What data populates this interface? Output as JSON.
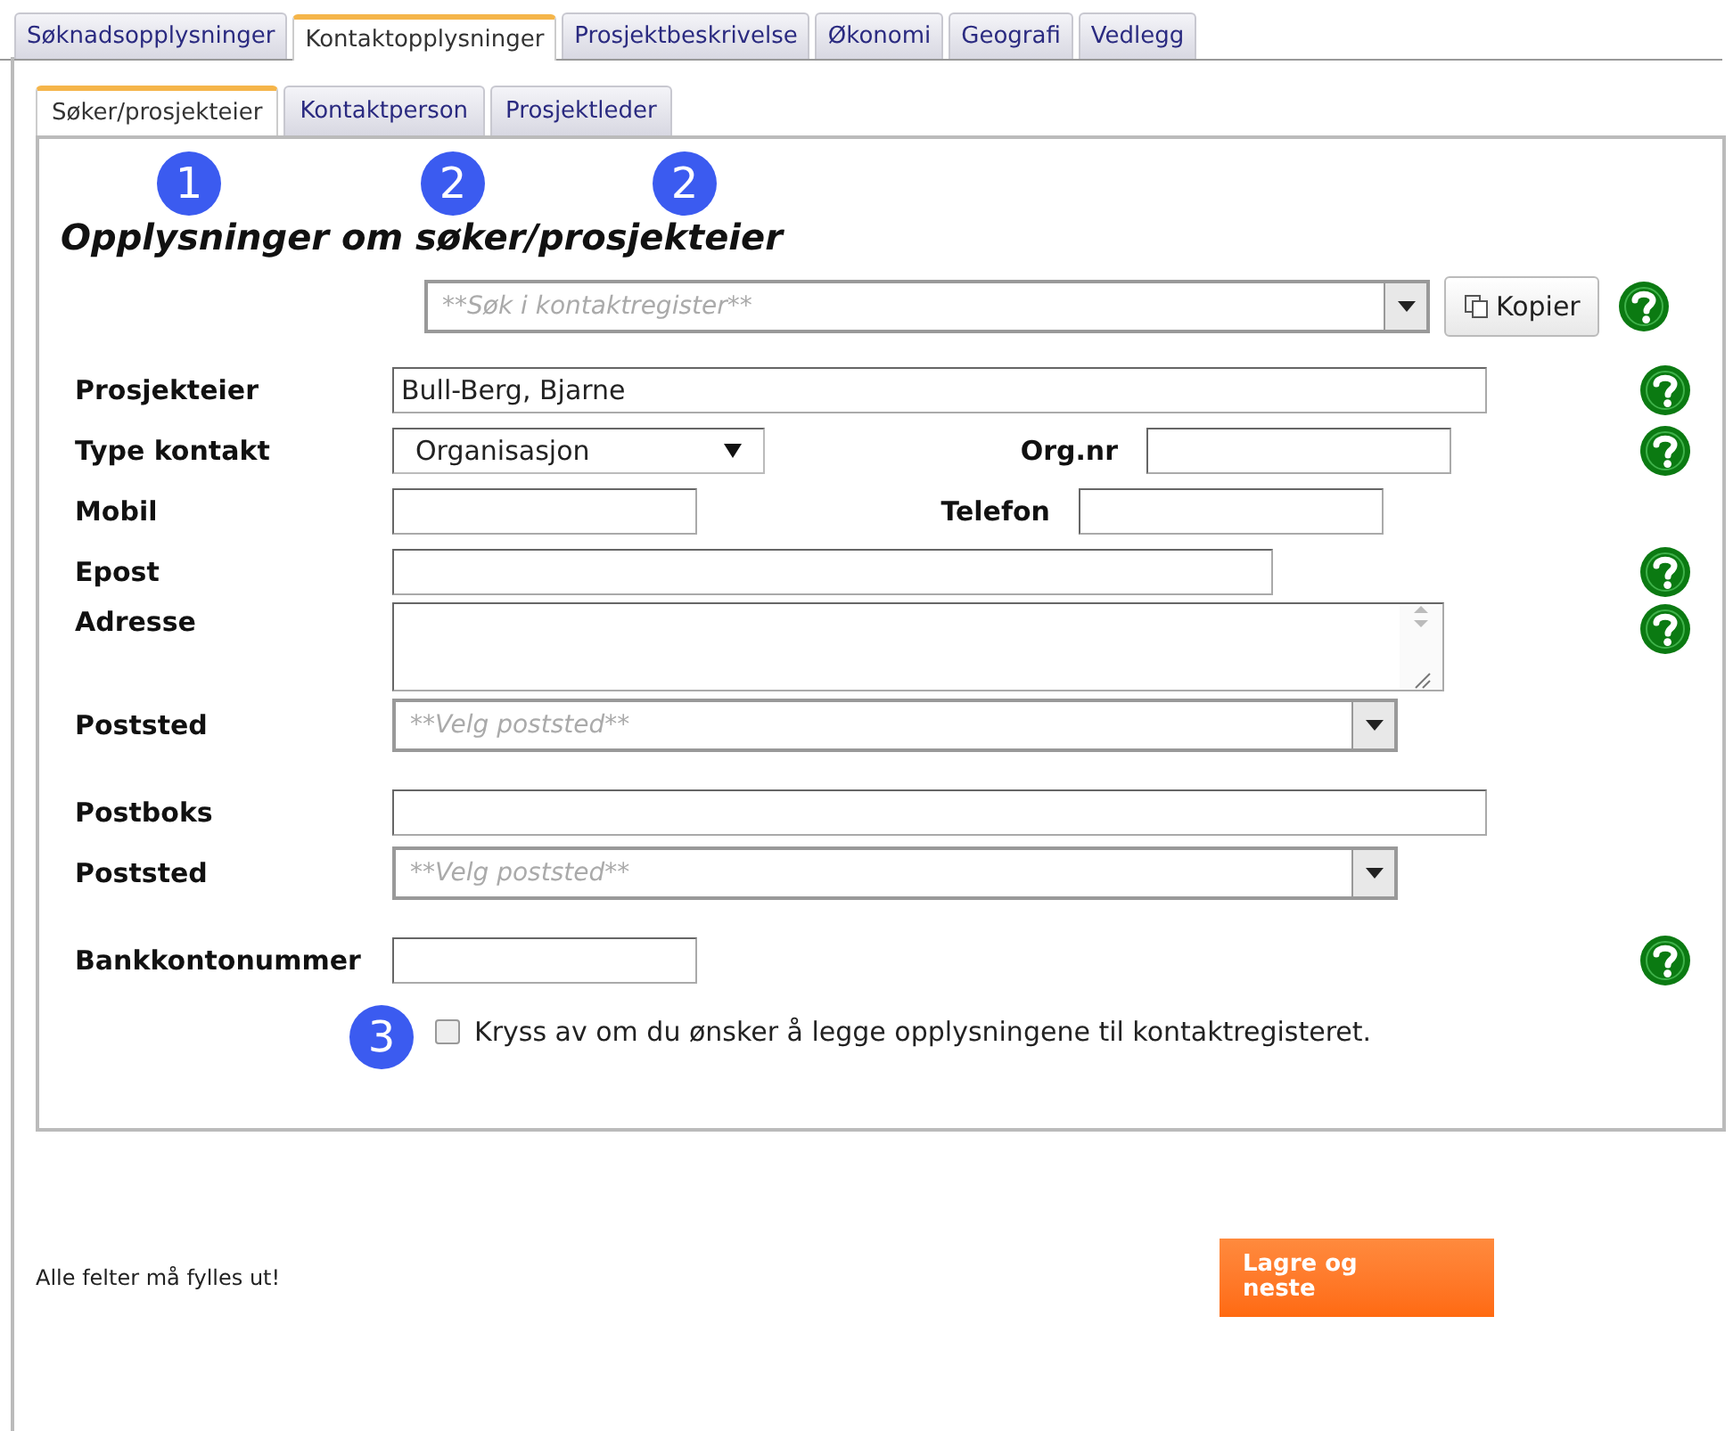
{
  "tabs": [
    {
      "label": "Søknadsopplysninger",
      "selected": false
    },
    {
      "label": "Kontaktopplysninger",
      "selected": true
    },
    {
      "label": "Prosjektbeskrivelse",
      "selected": false
    },
    {
      "label": "Økonomi",
      "selected": false
    },
    {
      "label": "Geografi",
      "selected": false
    },
    {
      "label": "Vedlegg",
      "selected": false
    }
  ],
  "subtabs": [
    {
      "label": "Søker/prosjekteier",
      "selected": true,
      "badge": "1"
    },
    {
      "label": "Kontaktperson",
      "selected": false,
      "badge": "2"
    },
    {
      "label": "Prosjektleder",
      "selected": false,
      "badge": "2"
    }
  ],
  "heading": "Opplysninger om søker/prosjekteier",
  "search": {
    "placeholder": "**Søk i kontaktregister**",
    "button": "Kopier",
    "help": true
  },
  "sections": [
    [
      {
        "label": "Prosjekteier",
        "field": {
          "kind": "text",
          "value": "Bull-Berg, Bjarne"
        },
        "help": true
      },
      {
        "label": "Type kontakt",
        "field": {
          "kind": "dropdown",
          "value": "Organisasjon"
        },
        "second": {
          "label": "Org.nr",
          "field": {
            "kind": "text"
          }
        },
        "help": true
      },
      {
        "label": "Mobil",
        "field": {
          "kind": "text"
        },
        "second": {
          "label": "Telefon",
          "field": {
            "kind": "text"
          }
        },
        "help": false
      },
      {
        "label": "Epost",
        "field": {
          "kind": "text"
        },
        "help": true
      },
      {
        "label": "Adresse",
        "field": {
          "kind": "textarea"
        },
        "help": true
      },
      {
        "label": "Poststed",
        "field": {
          "kind": "combo",
          "placeholder": "**Velg poststed**"
        },
        "help": false
      }
    ],
    [
      {
        "label": "Postboks",
        "field": {
          "kind": "text"
        },
        "help": false
      },
      {
        "label": "Poststed",
        "field": {
          "kind": "combo",
          "placeholder": "**Velg poststed**"
        },
        "help": false
      }
    ],
    [
      {
        "label": "Bankkontonummer",
        "field": {
          "kind": "text"
        },
        "help": true
      }
    ]
  ],
  "register": {
    "label": "Kryss av om du ønsker å legge opplysningene til kontaktregisteret.",
    "checked": false,
    "badge": "3"
  },
  "footer_note": "Alle felter må fylles ut!",
  "save_button": "Lagre og neste"
}
